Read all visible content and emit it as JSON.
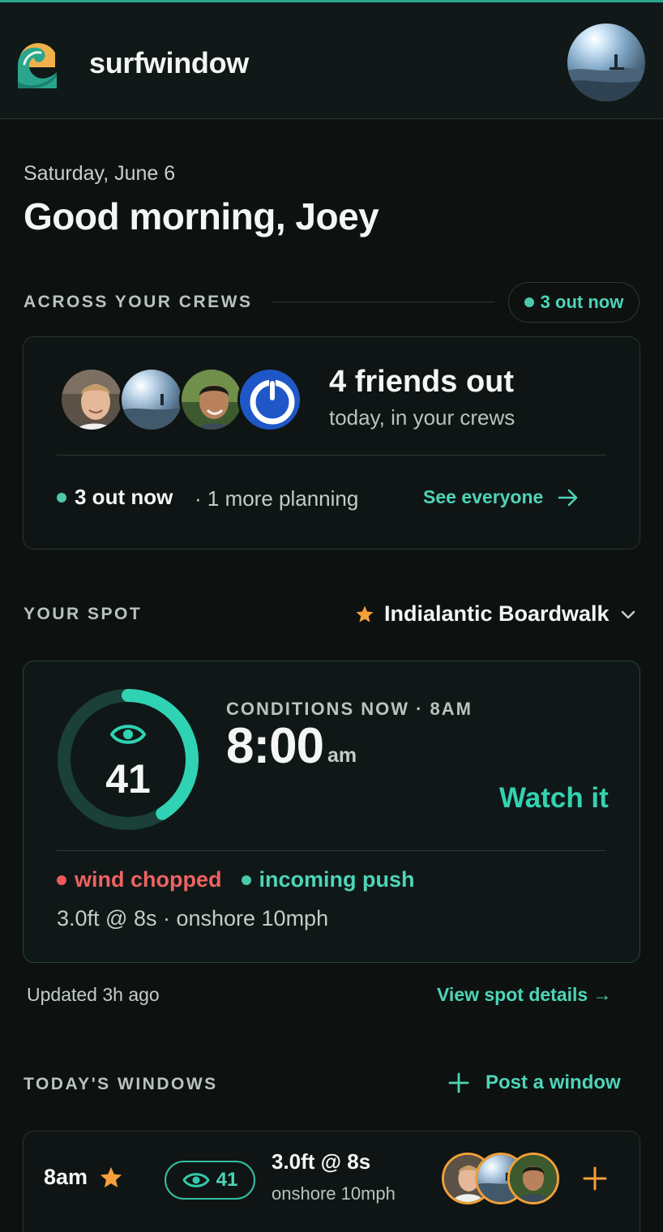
{
  "header": {
    "brand": "surfwindow",
    "logo_icon": "wave-sun-logo",
    "user_avatar": "user-avatar"
  },
  "hero": {
    "date": "Saturday, June 6",
    "greeting": "Good morning, Joey"
  },
  "crews": {
    "section_label": "ACROSS YOUR CREWS",
    "out_now_pill": "3 out now",
    "friends_title": "4 friends out",
    "friends_sub": "today, in your crews",
    "out_now": "3 out now",
    "planning": "· 1 more planning",
    "see_everyone": "See everyone",
    "friend_avatars": [
      "friend-avatar-1",
      "friend-avatar-2",
      "friend-avatar-3",
      "friend-avatar-4"
    ]
  },
  "spot": {
    "section_label": "YOUR SPOT",
    "spot_name": "Indialantic Boardwalk",
    "conditions_label": "CONDITIONS NOW · 8AM",
    "time": "8:00",
    "ampm": "am",
    "score": "41",
    "score_fraction": 0.41,
    "verdict": "Watch it",
    "tag_bad": "wind chopped",
    "tag_good": "incoming push",
    "meta": "3.0ft @ 8s · onshore 10mph",
    "updated": "Updated 3h ago",
    "view_details": "View spot details →"
  },
  "windows": {
    "section_label": "TODAY'S WINDOWS",
    "post_label": "Post a window",
    "items": [
      {
        "time": "8am",
        "score": "41",
        "swell": "3.0ft @ 8s",
        "wind": "onshore 10mph"
      }
    ]
  },
  "colors": {
    "accent": "#34d1b2",
    "star": "#f5a03a",
    "bad": "#ee5a5a",
    "background": "#0d1211"
  }
}
